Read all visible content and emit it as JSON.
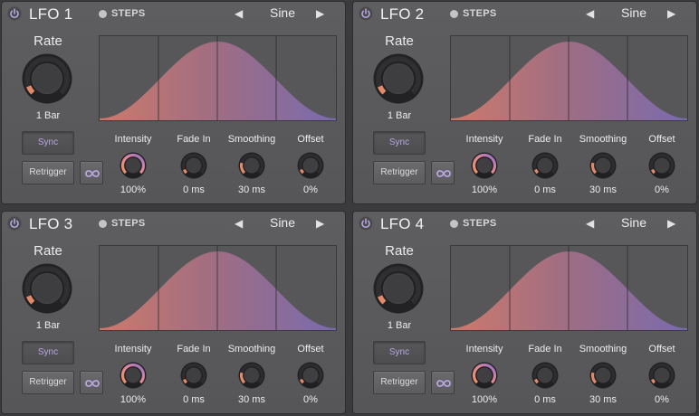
{
  "colors": {
    "accent_purple": "#b8a6e4",
    "warm": "#e38a6a",
    "wave_left": "#d07a6c",
    "wave_right": "#7c6cb0"
  },
  "lfos": [
    {
      "title": "LFO 1",
      "steps": "STEPS",
      "shape": "Sine",
      "rate_label": "Rate",
      "rate_value": "1 Bar",
      "sync": "Sync",
      "retrigger": "Retrigger",
      "knobs": [
        {
          "label": "Intensity",
          "value": "100%"
        },
        {
          "label": "Fade In",
          "value": "0 ms"
        },
        {
          "label": "Smoothing",
          "value": "30 ms"
        },
        {
          "label": "Offset",
          "value": "0%"
        }
      ]
    },
    {
      "title": "LFO 2",
      "steps": "STEPS",
      "shape": "Sine",
      "rate_label": "Rate",
      "rate_value": "1 Bar",
      "sync": "Sync",
      "retrigger": "Retrigger",
      "knobs": [
        {
          "label": "Intensity",
          "value": "100%"
        },
        {
          "label": "Fade In",
          "value": "0 ms"
        },
        {
          "label": "Smoothing",
          "value": "30 ms"
        },
        {
          "label": "Offset",
          "value": "0%"
        }
      ]
    },
    {
      "title": "LFO 3",
      "steps": "STEPS",
      "shape": "Sine",
      "rate_label": "Rate",
      "rate_value": "1 Bar",
      "sync": "Sync",
      "retrigger": "Retrigger",
      "knobs": [
        {
          "label": "Intensity",
          "value": "100%"
        },
        {
          "label": "Fade In",
          "value": "0 ms"
        },
        {
          "label": "Smoothing",
          "value": "30 ms"
        },
        {
          "label": "Offset",
          "value": "0%"
        }
      ]
    },
    {
      "title": "LFO 4",
      "steps": "STEPS",
      "shape": "Sine",
      "rate_label": "Rate",
      "rate_value": "1 Bar",
      "sync": "Sync",
      "retrigger": "Retrigger",
      "knobs": [
        {
          "label": "Intensity",
          "value": "100%"
        },
        {
          "label": "Fade In",
          "value": "0 ms"
        },
        {
          "label": "Smoothing",
          "value": "30 ms"
        },
        {
          "label": "Offset",
          "value": "0%"
        }
      ]
    }
  ]
}
